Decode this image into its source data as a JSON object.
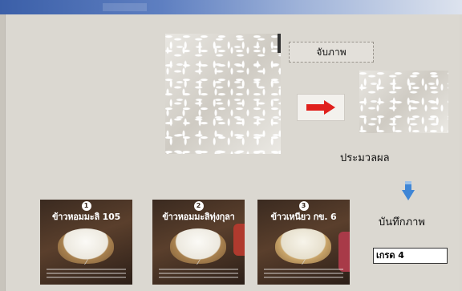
{
  "toolbar": {
    "capture_label": "จับภาพ",
    "process_label": "ประมวลผล",
    "save_label": "บันทึกภาพ"
  },
  "result": {
    "value": "เกรด 4"
  },
  "cards": [
    {
      "number": "1",
      "title": "ข้าวหอมมะลิ 105"
    },
    {
      "number": "2",
      "title": "ข้าวหอมมะลิทุ่งกุลา"
    },
    {
      "number": "3",
      "title": "ข้าวเหนียว กข. 6"
    }
  ],
  "colors": {
    "arrow": "#e0201c",
    "down_arrow": "#3f86d6",
    "titlebar": "#3b5fa8"
  },
  "icons": {
    "arrow_right": "right-arrow-icon",
    "arrow_down": "down-arrow-icon"
  }
}
